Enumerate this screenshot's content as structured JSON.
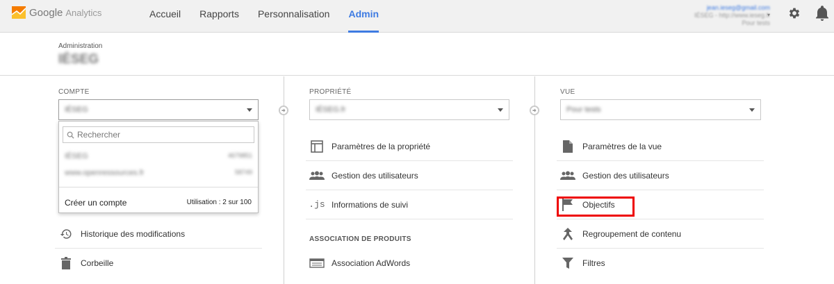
{
  "header": {
    "logo_brand": "Google",
    "logo_product": "Analytics",
    "nav": [
      "Accueil",
      "Rapports",
      "Personnalisation",
      "Admin"
    ],
    "active_nav": "Admin",
    "account_email": "jean.ieseg@gmail.com",
    "account_line2": "IÉSEG - http://www.ieseg.fr",
    "account_line3": "Pour tests"
  },
  "admin": {
    "label": "Administration",
    "account_name": "IÉSEG"
  },
  "compte": {
    "title": "COMPTE",
    "selected": "IÉSEG",
    "dropdown": {
      "search_placeholder": "Rechercher",
      "rows": [
        {
          "name": "IÉSEG",
          "id": "4679851"
        },
        {
          "name": "www.openressources.fr",
          "id": "58749"
        }
      ],
      "create_label": "Créer un compte",
      "usage": "Utilisation : 2 sur 100"
    },
    "items": [
      "Historique des modifications",
      "Corbeille"
    ]
  },
  "propriete": {
    "title": "PROPRIÉTÉ",
    "selected": "IÉSEG.fr",
    "items": [
      "Paramètres de la propriété",
      "Gestion des utilisateurs",
      "Informations de suivi"
    ],
    "section": "ASSOCIATION DE PRODUITS",
    "section_items": [
      "Association AdWords"
    ]
  },
  "vue": {
    "title": "VUE",
    "selected": "Pour tests",
    "items": [
      "Paramètres de la vue",
      "Gestion des utilisateurs",
      "Objectifs",
      "Regroupement de contenu",
      "Filtres"
    ]
  },
  "colors": {
    "accent": "#3e7be2",
    "highlight": "#e00000",
    "logo_orange": "#f57c00",
    "logo_yellow": "#fbc02d"
  }
}
